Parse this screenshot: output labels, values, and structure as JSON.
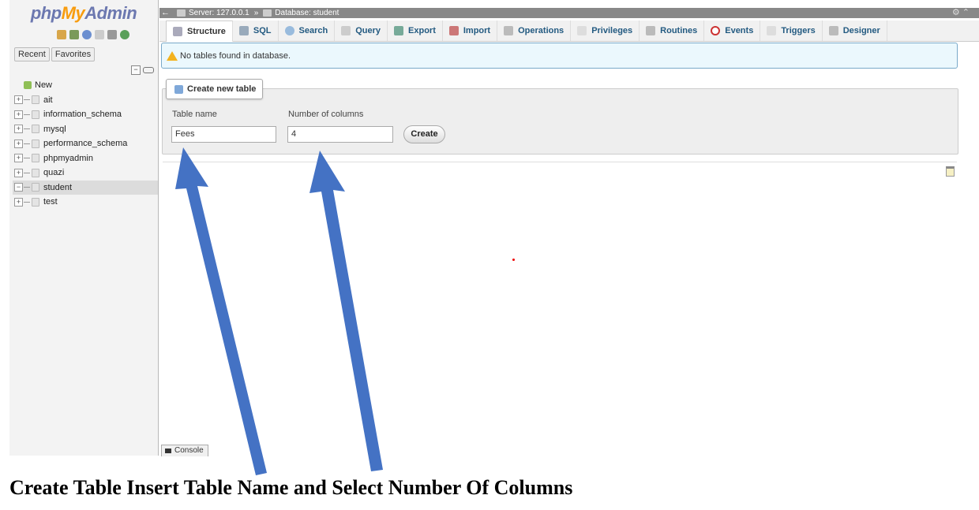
{
  "sidebar": {
    "logo": {
      "php": "php",
      "my": "My",
      "admin": "Admin"
    },
    "recent_tab": "Recent",
    "favorites_tab": "Favorites",
    "new_item": "New",
    "databases": [
      "ait",
      "information_schema",
      "mysql",
      "performance_schema",
      "phpmyadmin",
      "quazi",
      "student",
      "test"
    ],
    "active_database": "student"
  },
  "breadcrumb": {
    "server": "Server: 127.0.0.1",
    "separator": "»",
    "database": "Database: student"
  },
  "tabs": [
    {
      "label": "Structure",
      "icon": "structure-icon",
      "active": true
    },
    {
      "label": "SQL",
      "icon": "sql-icon"
    },
    {
      "label": "Search",
      "icon": "search-icon"
    },
    {
      "label": "Query",
      "icon": "query-icon"
    },
    {
      "label": "Export",
      "icon": "export-icon"
    },
    {
      "label": "Import",
      "icon": "import-icon"
    },
    {
      "label": "Operations",
      "icon": "wrench-icon"
    },
    {
      "label": "Privileges",
      "icon": "privileges-icon"
    },
    {
      "label": "Routines",
      "icon": "routines-icon"
    },
    {
      "label": "Events",
      "icon": "clock-icon"
    },
    {
      "label": "Triggers",
      "icon": "triggers-icon"
    },
    {
      "label": "Designer",
      "icon": "designer-icon"
    }
  ],
  "notice": {
    "text": "No tables found in database."
  },
  "create_table": {
    "legend": "Create new table",
    "table_name_label": "Table name",
    "table_name_value": "Fees",
    "columns_label": "Number of columns",
    "columns_value": "4",
    "create_button": "Create"
  },
  "console": {
    "label": "Console"
  },
  "caption": "Create Table Insert Table Name and Select Number Of Columns",
  "colors": {
    "arrow": "#4472c4",
    "link": "#235a81",
    "notice_bg": "#ebf8fd"
  }
}
